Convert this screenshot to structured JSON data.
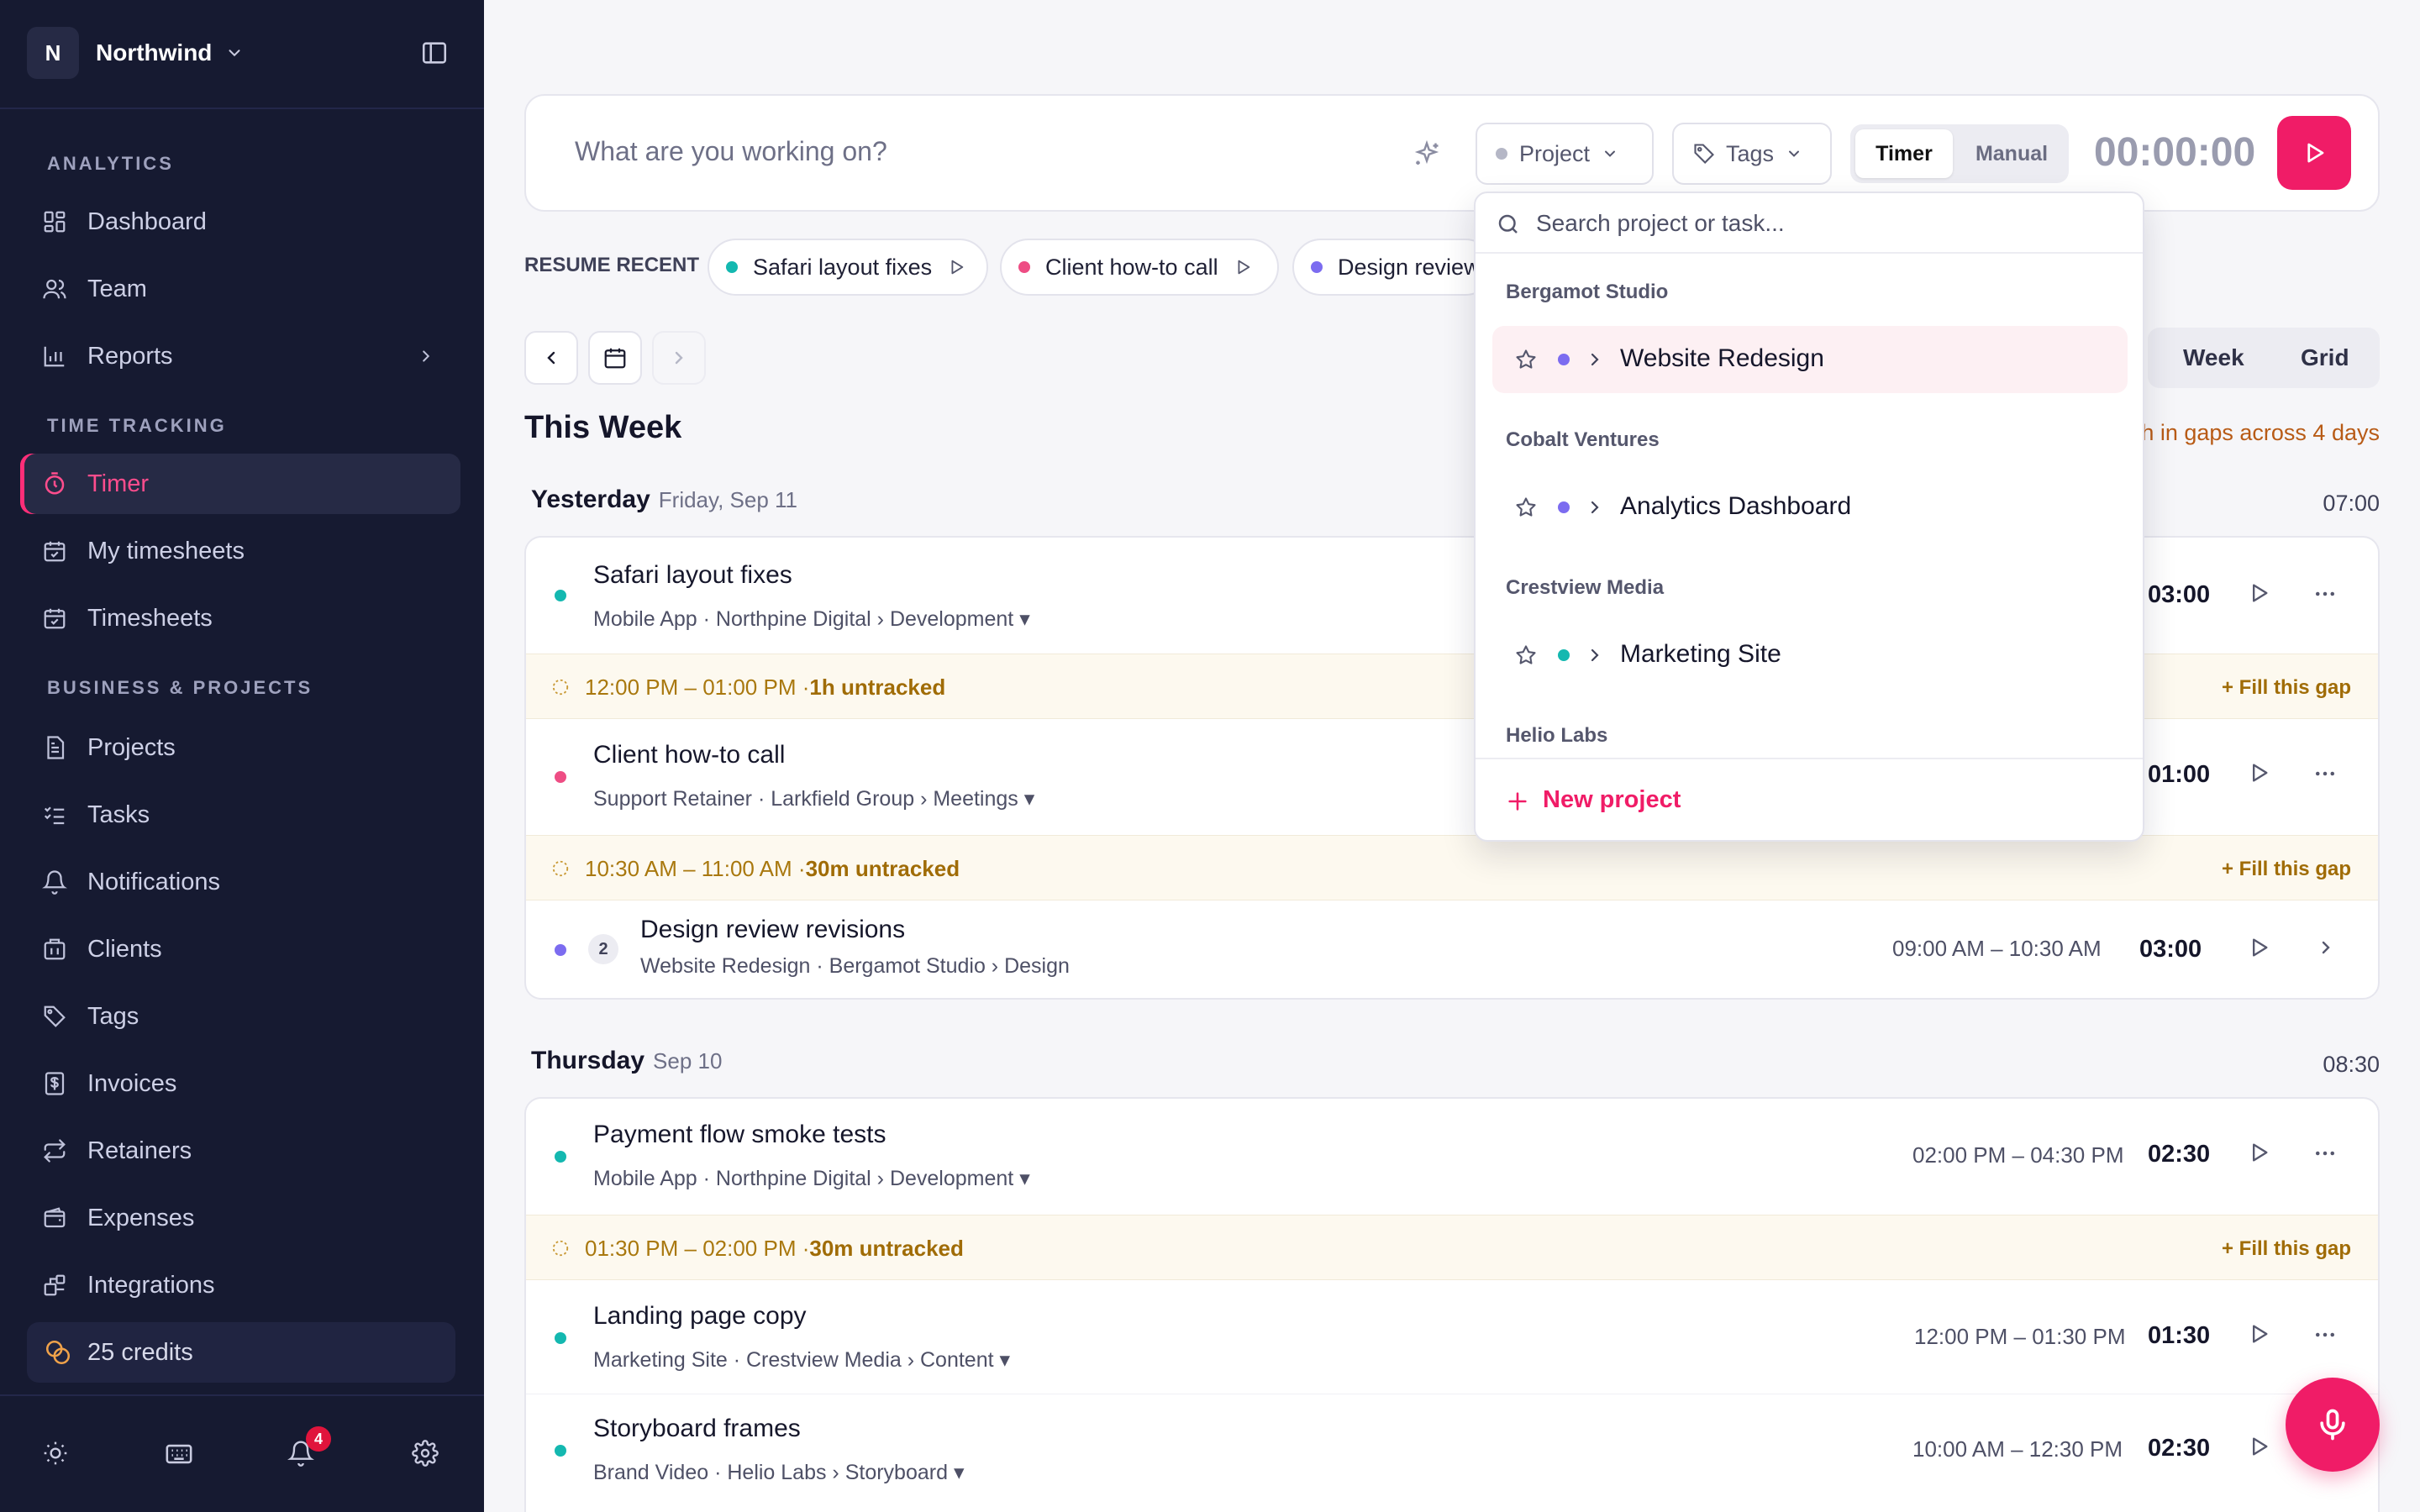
{
  "workspace": {
    "badge": "N",
    "name": "Northwind"
  },
  "sidebar": {
    "sections": {
      "analytics": "ANALYTICS",
      "time": "TIME TRACKING",
      "business": "BUSINESS & PROJECTS"
    },
    "items": {
      "dashboard": "Dashboard",
      "team": "Team",
      "reports": "Reports",
      "timer": "Timer",
      "my_timesheets": "My timesheets",
      "timesheets": "Timesheets",
      "projects": "Projects",
      "tasks": "Tasks",
      "notifications": "Notifications",
      "clients": "Clients",
      "tags": "Tags",
      "invoices": "Invoices",
      "retainers": "Retainers",
      "expenses": "Expenses",
      "integrations": "Integrations"
    },
    "credits": "25 credits",
    "notif_count": "4"
  },
  "topbar": {
    "placeholder": "What are you working on?",
    "project_label": "Project",
    "tags_label": "Tags",
    "mode_timer": "Timer",
    "mode_manual": "Manual",
    "clock": "00:00:00"
  },
  "recent": {
    "label": "RESUME RECENT",
    "chips": [
      {
        "label": "Safari layout fixes",
        "color": "#14b8b0"
      },
      {
        "label": "Client how-to call",
        "color": "#ee4d84"
      },
      {
        "label": "Design review",
        "color": "#7c6cf0"
      }
    ]
  },
  "view": {
    "week": "Week",
    "grid": "Grid"
  },
  "week_title": "This Week",
  "gaps_note": "h in gaps across 4 days",
  "days": [
    {
      "name": "Yesterday",
      "date": "Friday, Sep 11",
      "total": "07:00",
      "entries": [
        {
          "title": "Safari layout fixes",
          "sub": "Mobile App · Northpine Digital › Development",
          "dur": "03:00",
          "color": "#14b8b0"
        },
        {
          "gap": "12:00 PM – 01:00 PM ·",
          "gap_len": "1h untracked",
          "fill": "+ Fill this gap"
        },
        {
          "title": "Client how-to call",
          "sub": "Support Retainer · Larkfield Group › Meetings",
          "dur": "01:00",
          "color": "#ee4d84"
        },
        {
          "gap": "10:30 AM – 11:00 AM ·",
          "gap_len": "30m untracked",
          "fill": "+ Fill this gap"
        },
        {
          "count": "2",
          "title": "Design review revisions",
          "sub": "Website Redesign · Bergamot Studio › Design",
          "range": "09:00 AM – 10:30 AM",
          "dur": "03:00",
          "color": "#7c6cf0"
        }
      ]
    },
    {
      "name": "Thursday",
      "date": "Sep 10",
      "total": "08:30",
      "entries": [
        {
          "title": "Payment flow smoke tests",
          "sub": "Mobile App · Northpine Digital › Development",
          "range": "02:00 PM – 04:30 PM",
          "dur": "02:30",
          "color": "#14b8b0"
        },
        {
          "gap": "01:30 PM – 02:00 PM ·",
          "gap_len": "30m untracked",
          "fill": "+ Fill this gap"
        },
        {
          "title": "Landing page copy",
          "sub": "Marketing Site · Crestview Media › Content",
          "range": "12:00 PM – 01:30 PM",
          "dur": "01:30",
          "color": "#14b8b0"
        },
        {
          "title": "Storyboard frames",
          "sub": "Brand Video · Helio Labs › Storyboard",
          "range": "10:00 AM – 12:30 PM",
          "dur": "02:30",
          "color": "#14b8b0"
        }
      ]
    }
  ],
  "dropdown": {
    "search_placeholder": "Search project or task...",
    "groups": [
      {
        "client": "Bergamot Studio",
        "project": "Website Redesign",
        "color": "#7c6cf0"
      },
      {
        "client": "Cobalt Ventures",
        "project": "Analytics Dashboard",
        "color": "#7c6cf0"
      },
      {
        "client": "Crestview Media",
        "project": "Marketing Site",
        "color": "#14b8b0"
      },
      {
        "client": "Helio Labs"
      }
    ],
    "new_project": "New project"
  }
}
